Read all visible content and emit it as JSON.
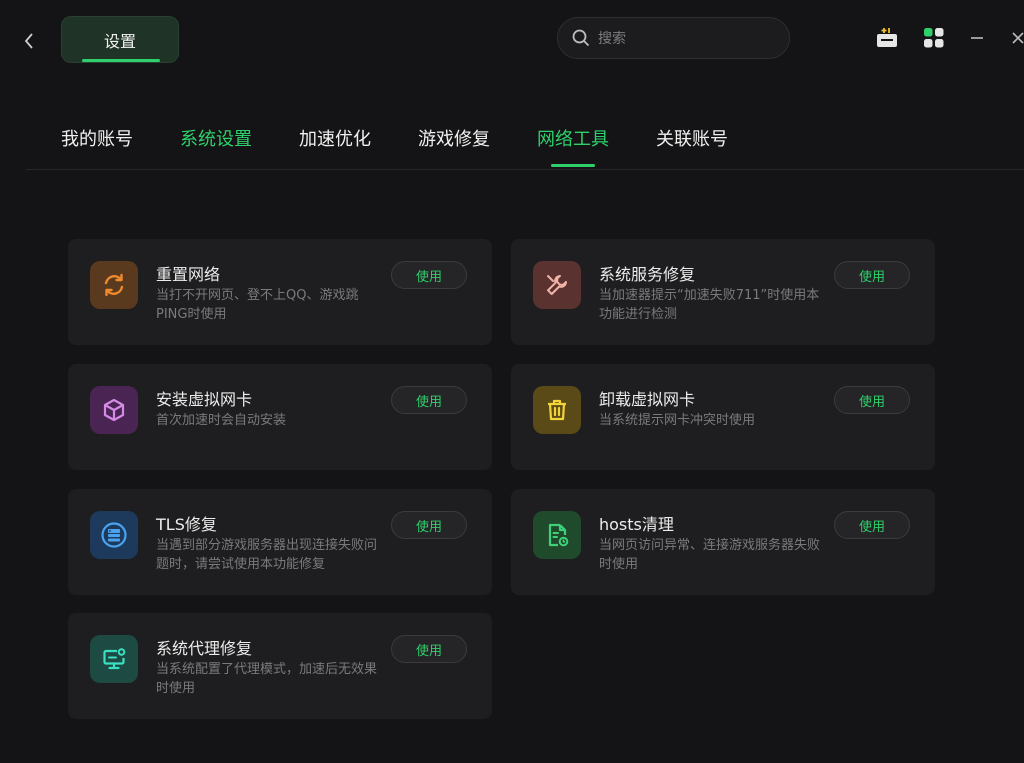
{
  "header": {
    "settings_label": "设置",
    "search_placeholder": "搜索",
    "icons": [
      "back-icon",
      "gift-box-icon",
      "apps-grid-icon",
      "minimize-icon",
      "close-icon"
    ]
  },
  "tabs": [
    {
      "label": "我的账号"
    },
    {
      "label": "系统设置"
    },
    {
      "label": "加速优化"
    },
    {
      "label": "游戏修复"
    },
    {
      "label": "网络工具"
    },
    {
      "label": "关联账号"
    }
  ],
  "active_tab": "网络工具",
  "tools": [
    {
      "title": "重置网络",
      "desc": "当打不开网页、登不上QQ、游戏跳PING时使用",
      "button": "使用",
      "icon": "refresh-icon",
      "icon_bg": "#5a3a1e",
      "icon_color": "#f08a2c"
    },
    {
      "title": "系统服务修复",
      "desc": "当加速器提示“加速失败711”时使用本功能进行检测",
      "button": "使用",
      "icon": "wrench-icon",
      "icon_bg": "#5a3330",
      "icon_color": "#f2b4a8"
    },
    {
      "title": "安装虚拟网卡",
      "desc": "首次加速时会自动安装",
      "button": "使用",
      "icon": "cube-icon",
      "icon_bg": "#4a2553",
      "icon_color": "#d58ae6"
    },
    {
      "title": "卸载虚拟网卡",
      "desc": "当系统提示网卡冲突时使用",
      "button": "使用",
      "icon": "trash-icon",
      "icon_bg": "#5a4a17",
      "icon_color": "#f2d43a"
    },
    {
      "title": "TLS修复",
      "desc": "当遇到部分游戏服务器出现连接失败问题时，请尝试使用本功能修复",
      "button": "使用",
      "icon": "server-repair-icon",
      "icon_bg": "#1d3a5c",
      "icon_color": "#4aa3f0"
    },
    {
      "title": "hosts清理",
      "desc": "当网页访问异常、连接游戏服务器失败时使用",
      "button": "使用",
      "icon": "file-clean-icon",
      "icon_bg": "#1f4a2b",
      "icon_color": "#3fd07a"
    },
    {
      "title": "系统代理修复",
      "desc": "当系统配置了代理模式，加速后无效果时使用",
      "button": "使用",
      "icon": "monitor-icon",
      "icon_bg": "#1d4a42",
      "icon_color": "#3be0c2"
    }
  ],
  "colors": {
    "accent": "#2fd06b",
    "background": "#141416",
    "card": "#1e1e20"
  }
}
